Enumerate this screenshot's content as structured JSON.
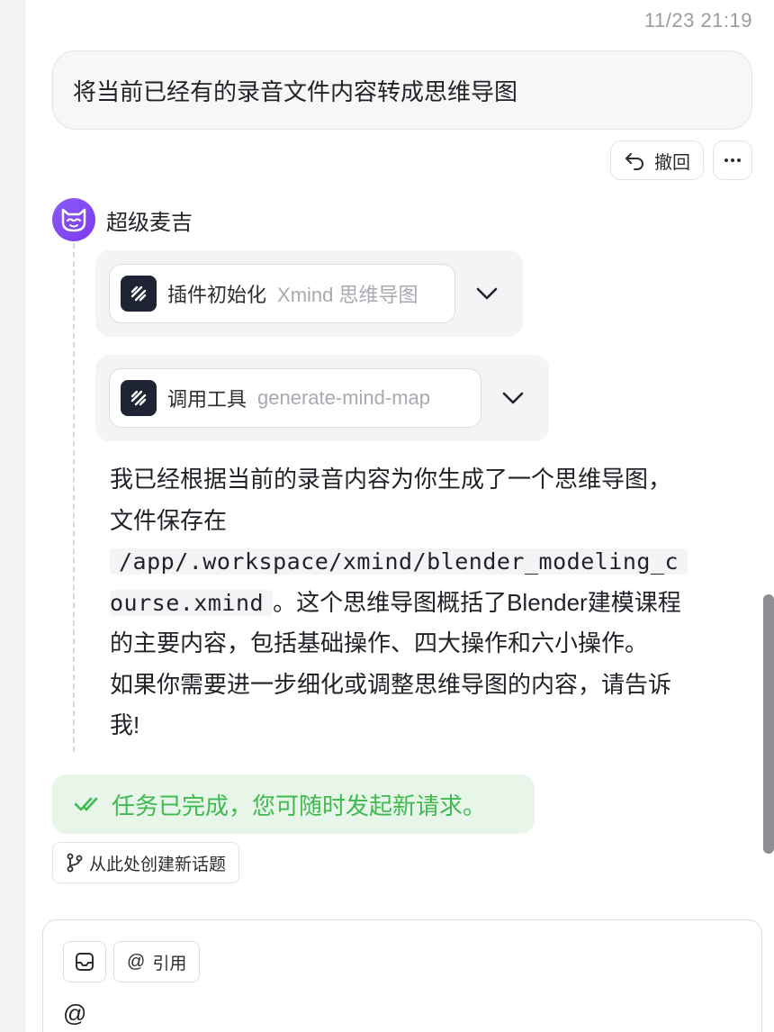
{
  "timestamp": "11/23 21:19",
  "user_message": "将当前已经有的录音文件内容转成思维导图",
  "message_actions": {
    "undo_label": "撤回",
    "more_label": "···"
  },
  "bot": {
    "name": "超级麦吉"
  },
  "tool_calls": [
    {
      "title": "插件初始化",
      "subtitle": "Xmind 思维导图"
    },
    {
      "title": "调用工具",
      "subtitle": "generate-mind-map"
    }
  ],
  "reply": {
    "line1": "我已经根据当前的录音内容为你生成了一个思维导图，",
    "line2": "文件保存在",
    "path_part1": "/app/.workspace/xmind/blender_modeling_c",
    "path_part2": "ourse.xmind",
    "after_path": "。这个思维导图概括了Blender建模课程",
    "line5": "的主要内容，包括基础操作、四大操作和六小操作。",
    "line6": "如果你需要进一步细化或调整思维导图的内容，请告诉",
    "line7": "我!"
  },
  "status_banner": "任务已完成，您可随时发起新请求。",
  "branch_button": "从此处创建新话题",
  "input": {
    "mention_label": "引用",
    "text": "@"
  },
  "colors": {
    "accent_purple": "#8b5cf6",
    "success_green": "#3fb950",
    "success_bg": "#e8f6e9"
  },
  "icons": [
    "undo-icon",
    "more-icon",
    "bot-avatar-icon",
    "xmind-plugin-icon",
    "chevron-down-icon",
    "double-check-icon",
    "branch-icon",
    "inbox-icon",
    "at-icon"
  ]
}
